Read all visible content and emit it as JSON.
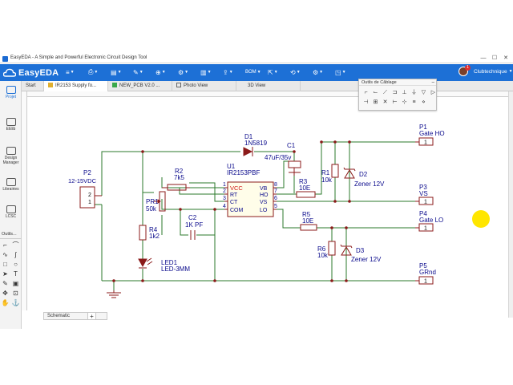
{
  "window": {
    "title": "EasyEDA - A Simple and Powerful Electronic Circuit Design Tool",
    "minimize": "—",
    "maximize": "☐",
    "close": "✕"
  },
  "appbar": {
    "logo_text": "EasyEDA",
    "brand_color": "#1d70d6",
    "menu_icons": [
      "file-icon",
      "save-icon",
      "doc-icon",
      "pen-icon",
      "place-icon",
      "gear-icon",
      "fabricate-icon",
      "share-icon",
      "bom-icon",
      "export-icon",
      "history-icon",
      "settings-icon",
      "view-icon"
    ],
    "toolbar_icons": [
      "align-icon",
      "delete-icon",
      "bom-icon",
      "fabricate-icon",
      "share-icon",
      "history-icon",
      "settings-icon",
      "import-icon"
    ],
    "bom_label": "BOM",
    "user": {
      "name": "Clubtechnique",
      "notifications": "1"
    }
  },
  "sidebar": {
    "items": [
      {
        "label": "Projet",
        "icon": "folder-icon"
      },
      {
        "label": "EElib",
        "icon": "chip-icon"
      },
      {
        "label": "Design Manager",
        "icon": "tree-icon"
      },
      {
        "label": "Librairies",
        "icon": "library-icon"
      },
      {
        "label": "LCSC",
        "icon": "lcsc-icon"
      }
    ],
    "outils_title": "Outils..."
  },
  "tabs": [
    {
      "label": "Start",
      "icon": ""
    },
    {
      "label": "IR2153 Supply fo...",
      "icon": "schematic-icon"
    },
    {
      "label": "NEW_PCB V2.0 ...",
      "icon": "pcb-icon"
    },
    {
      "label": "Photo View",
      "icon": "photo-icon"
    },
    {
      "label": "3D View",
      "icon": "3d-icon"
    }
  ],
  "palette": {
    "title": "Outils de Câblage"
  },
  "sheet": {
    "tab_label": "Schematic",
    "add_label": "+"
  },
  "schematic": {
    "p2": {
      "ref": "P2",
      "value": "12-15VDC",
      "pin2": "2",
      "pin1": "1"
    },
    "d1": {
      "ref": "D1",
      "value": "1N5819"
    },
    "c1": {
      "ref": "C1",
      "value": "47uF/35v"
    },
    "r2": {
      "ref": "R2",
      "value": "7k5"
    },
    "pr1": {
      "ref": "PR1",
      "value": "50k"
    },
    "r4": {
      "ref": "R4",
      "value": "1k2"
    },
    "c2": {
      "ref": "C2",
      "value": "1K PF"
    },
    "led1": {
      "ref": "LED1",
      "value": "LED-3MM"
    },
    "u1": {
      "ref": "U1",
      "value": "IR2153PBF",
      "left_pins": [
        {
          "num": "1",
          "name": "VCC"
        },
        {
          "num": "2",
          "name": "RT"
        },
        {
          "num": "3",
          "name": "CT"
        },
        {
          "num": "4",
          "name": "COM"
        }
      ],
      "right_pins": [
        {
          "num": "8",
          "name": "VB"
        },
        {
          "num": "7",
          "name": "HO"
        },
        {
          "num": "6",
          "name": "VS"
        },
        {
          "num": "5",
          "name": "LO"
        }
      ]
    },
    "r3": {
      "ref": "R3",
      "value": "10E"
    },
    "r1": {
      "ref": "R1",
      "value": "10k"
    },
    "d2": {
      "ref": "D2",
      "value": "Zener 12V"
    },
    "r5": {
      "ref": "R5",
      "value": "10E"
    },
    "r6": {
      "ref": "R6",
      "value": "10k"
    },
    "d3": {
      "ref": "D3",
      "value": "Zener 12V"
    },
    "p1": {
      "ref": "P1",
      "value": "Gate HO",
      "pin": "1"
    },
    "p3": {
      "ref": "P3",
      "value": "VS",
      "pin": "1"
    },
    "p4": {
      "ref": "P4",
      "value": "Gate LO",
      "pin": "1"
    },
    "p5": {
      "ref": "P5",
      "value": "GRnd",
      "pin": "1"
    },
    "colors": {
      "wire": "#2b7a2b",
      "part": "#8b1a1a",
      "text": "#0a0a8c"
    }
  }
}
